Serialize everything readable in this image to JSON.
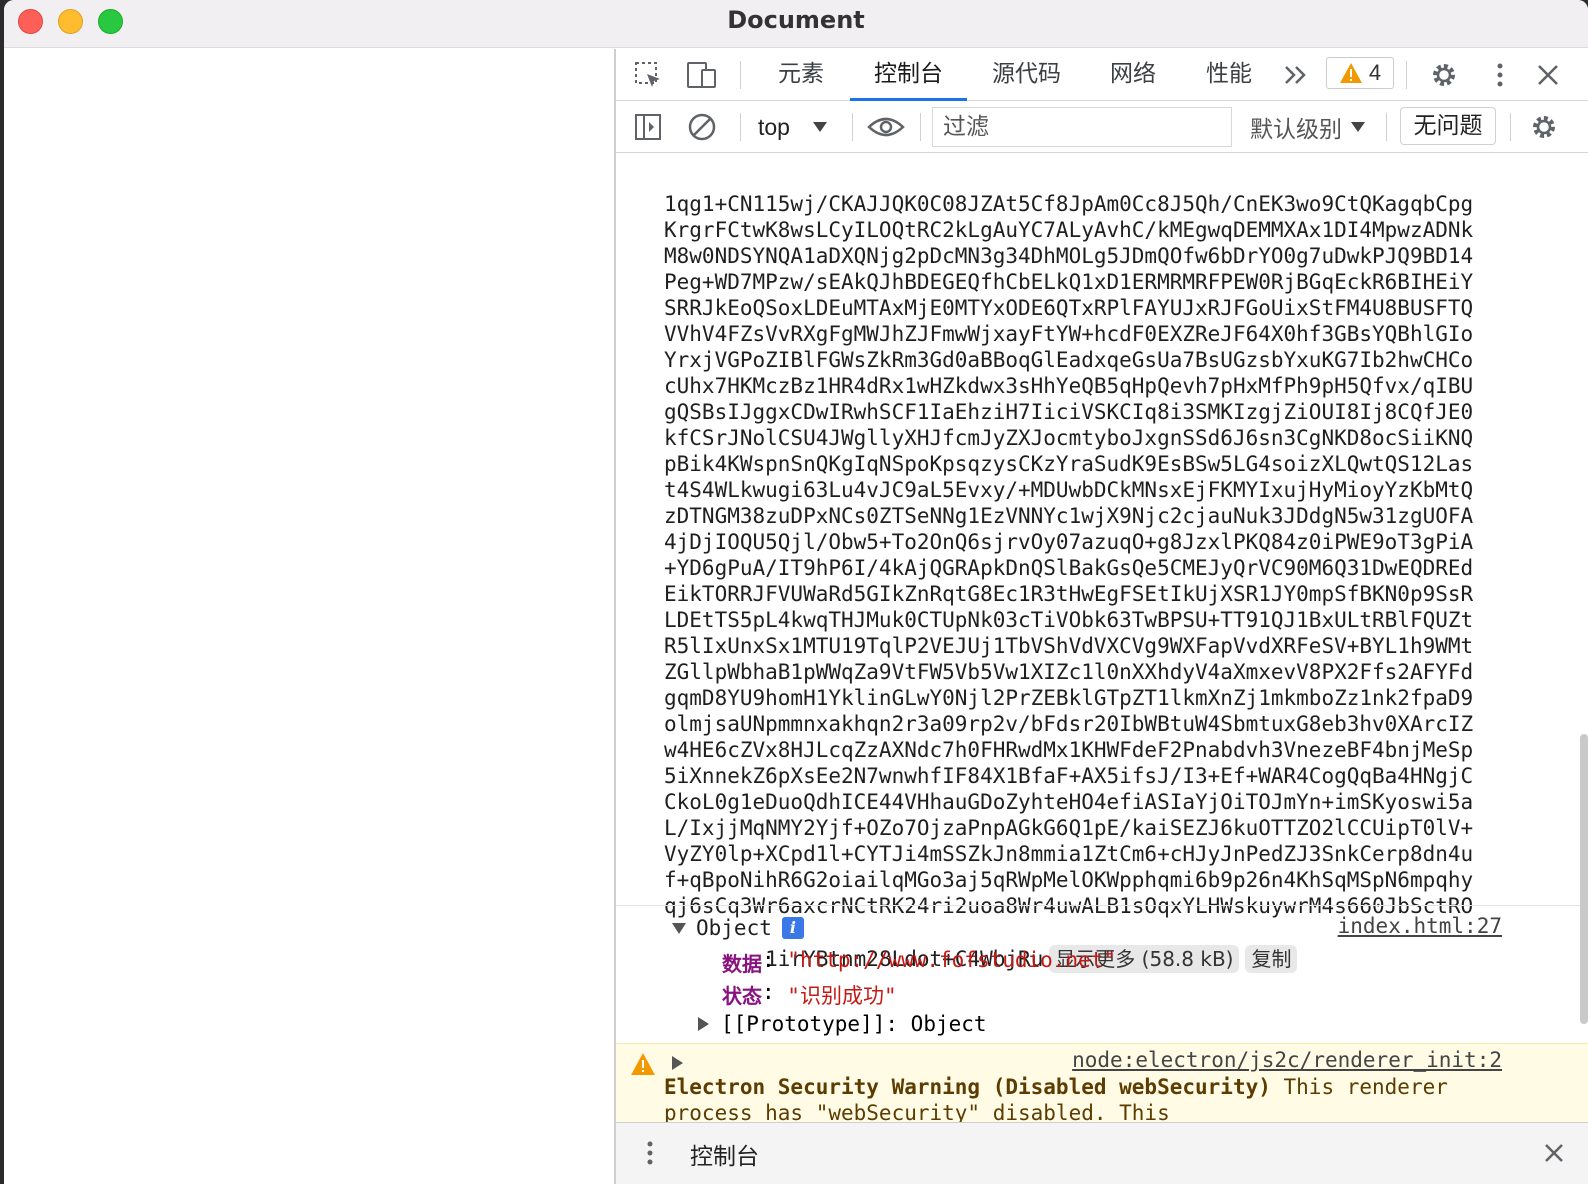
{
  "window": {
    "title": "Document"
  },
  "devtools": {
    "tabs": [
      "元素",
      "控制台",
      "源代码",
      "网络",
      "性能"
    ],
    "active_tab": "控制台",
    "issues_count": "4",
    "toolbar": {
      "context": "top",
      "filter_placeholder": "过滤",
      "levels": "默认级别",
      "issues_button": "无问题"
    }
  },
  "console": {
    "b64_lines": [
      "1qg1+CN115wj/CKAJJQK0C08JZAt5Cf8JpAm0Cc8J5Qh/CnEK3wo9CtQKagqbCpg",
      "KrgrFCtwK8wsLCyILOQtRC2kLgAuYC7ALyAvhC/kMEgwqDEMMXAx1DI4MpwzADNk",
      "M8w0NDSYNQA1aDXQNjg2pDcMN3g34DhMOLg5JDmQOfw6bDrYO0g7uDwkPJQ9BD14",
      "Peg+WD7MPzw/sEAkQJhBDEGEQfhCbELkQ1xD1ERMRMRFPEW0RjBGqEckR6BIHEiY",
      "SRRJkEoQSoxLDEuMTAxMjE0MTYxODE6QTxRPlFAYUJxRJFGoUixStFM4U8BUSFTQ",
      "VVhV4FZsVvRXgFgMWJhZJFmwWjxayFtYW+hcdF0EXZReJF64X0hf3GBsYQBhlGIo",
      "YrxjVGPoZIBlFGWsZkRm3Gd0aBBoqGlEadxqeGsUa7BsUGzsbYxuKG7Ib2hwCHCo",
      "cUhx7HKMczBz1HR4dRx1wHZkdwx3sHhYeQB5qHpQevh7pHxMfPh9pH5Qfvx/qIBU",
      "gQSBsIJggxCDwIRwhSCF1IaEhziH7IiciVSKCIq8i3SMKIzgjZiOUI8Ij8CQfJE0",
      "kfCSrJNolCSU4JWgllyXHJfcmJyZXJocmtyboJxgnSSd6J6sn3CgNKD8ocSiiKNQ",
      "pBik4KWspnSnQKgIqNSpoKpsqzysCKzYraSudK9EsBSw5LG4soizXLQwtQS12Las",
      "t4S4WLkwugi63Lu4vJC9aL5Evxy/+MDUwbDCkMNsxEjFKMYIxujHyMioyYzKbMtQ",
      "zDTNGM38zuDPxNCs0ZTSeNNg1EzVNNYc1wjX9Njc2cjauNuk3JDdgN5w31zgUOFA",
      "4jDjIOQU5Qjl/Obw5+To2OnQ6sjrvOy07azuqO+g8JzxlPKQ84z0iPWE9oT3gPiA",
      "+YD6gPuA/IT9hP6I/4kAjQGRApkDnQSlBakGsQe5CMEJyQrVC90M6Q31DwEQDREd",
      "EikTORRJFVUWaRd5GIkZnRqtG8Ec1R3tHwEgFSEtIkUjXSR1JY0mpSfBKN0p9SsR",
      "LDEtTS5pL4kwqTHJMuk0CTUpNk03cTiVObk63TwBPSU+TT91QJ1BxULtRBlFQUZt",
      "R5lIxUnxSx1MTU19TqlP2VEJUj1TbVShVdVXCVg9WXFapVvdXRFeSV+BYL1h9WMt",
      "ZGllpWbhaB1pWWqZa9VtFW5Vb5Vw1XIZc1l0nXXhdyV4aXmxevV8PX2Ffs2AFYFd",
      "gqmD8YU9homH1YklinGLwY0Njl2PrZEBklGTpZT1lkmXnZj1mkmboZz1nk2fpaD9",
      "olmjsaUNpmmnxakhqn2r3a09rp2v/bFdsr20IbWBtuW4SbmtuxG8eb3hv0XArcIZ",
      "w4HE6cZVx8HJLcqZzAXNdc7h0FHRwdMx1KHWFdeF2Pnabdvh3VnezeBF4bnjMeSp",
      "5iXnnekZ6pXsEe2N7wnwhfIF84X1BfaF+AX5ifsJ/I3+Ef+WAR4CogQqBa4HNgjC",
      "CkoL0g1eDuoQdhICE44VHhauGDoZyhteHO4efiASIaYjOiTOJmYn+imSKyoswi5a",
      "L/IxjjMqNMY2Yjf+OZo7OjzaPnpAGkG6Q1pE/kaiSEZJ6kuOTTZO2lCCUipT0lV+",
      "VyZY0lp+XCpd1l+CYTJi4mSSZkJn8mmia1ZtCm6+cHJyJnPedZJ3SnkCerp8dn4u",
      "f+qBpoNihR6G2oiailqMGo3aj5qRWpMelOKWpphqmi6b9p26n4KhSqMSpN6mpqhy",
      "qj6sCq3Wr6axcrNCtRK24ri2uoa8Wr4uwALB1sOqxYLHWskuywrM4s660JbSctRO"
    ],
    "b64_last": "1irYBtnm28Ldot+C4WbjRu",
    "show_more": "显示更多 (58.8 kB)",
    "copy": "复制",
    "object": {
      "label": "Object",
      "source": "index.html:27",
      "props": [
        {
          "key": "数据",
          "value": "\"http://www.fofstudio.net\""
        },
        {
          "key": "状态",
          "value": "\"识别成功\""
        }
      ],
      "prototype_key": "[[Prototype]]",
      "prototype_value": "Object"
    },
    "warning": {
      "source": "node:electron/js2c/renderer_init:2",
      "title": "Electron Security Warning (Disabled webSecurity)",
      "text": " This renderer process has \"webSecurity\" disabled. This"
    }
  },
  "drawer": {
    "tab": "控制台"
  }
}
